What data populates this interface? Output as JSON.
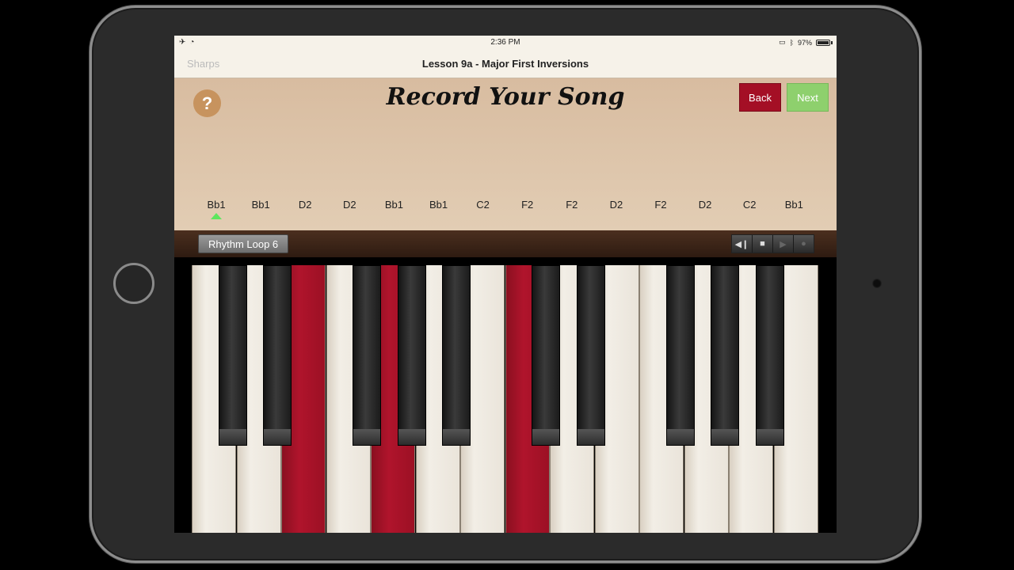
{
  "status": {
    "time": "2:36 PM",
    "battery": "97%"
  },
  "nav": {
    "left": "Sharps",
    "title": "Lesson 9a - Major First Inversions"
  },
  "header": {
    "title": "Record Your Song",
    "help": "?",
    "back": "Back",
    "next": "Next"
  },
  "notes": [
    "Bb1",
    "Bb1",
    "D2",
    "D2",
    "Bb1",
    "Bb1",
    "C2",
    "F2",
    "F2",
    "D2",
    "F2",
    "D2",
    "C2",
    "Bb1"
  ],
  "current_note_index": 0,
  "toolbar": {
    "loop_label": "Rhythm Loop 6"
  },
  "keyboard": {
    "white_key_count": 14,
    "active_white_keys": [
      2,
      4,
      7
    ]
  },
  "colors": {
    "accent_red": "#a40f25",
    "next_green": "#8ed06d",
    "panel": "#d8bca0"
  }
}
